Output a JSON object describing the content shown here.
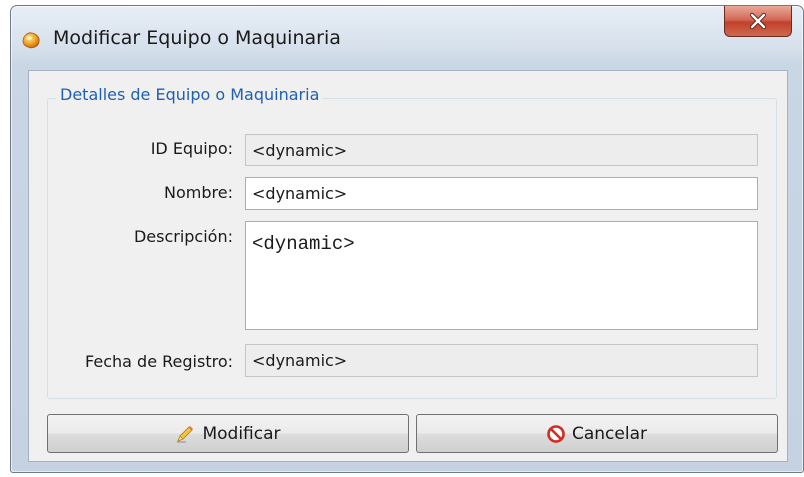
{
  "window": {
    "title": "Modificar Equipo o Maquinaria",
    "app_icon": "app-icon",
    "close_icon": "close-icon"
  },
  "group": {
    "legend": "Detalles de Equipo o Maquinaria"
  },
  "fields": {
    "id": {
      "label": "ID Equipo:",
      "value": "<dynamic>"
    },
    "nombre": {
      "label": "Nombre:",
      "value": "<dynamic>"
    },
    "descripcion": {
      "label": "Descripción:",
      "value": "<dynamic>"
    },
    "fecha": {
      "label": "Fecha de Registro:",
      "value": "<dynamic>"
    }
  },
  "buttons": {
    "modificar": {
      "label": "Modificar",
      "icon": "pencil-icon"
    },
    "cancelar": {
      "label": "Cancelar",
      "icon": "cancel-icon"
    }
  },
  "colors": {
    "legend": "#1f5fb5",
    "close_button": "#c0412b",
    "cancel_icon": "#d42a1f"
  }
}
